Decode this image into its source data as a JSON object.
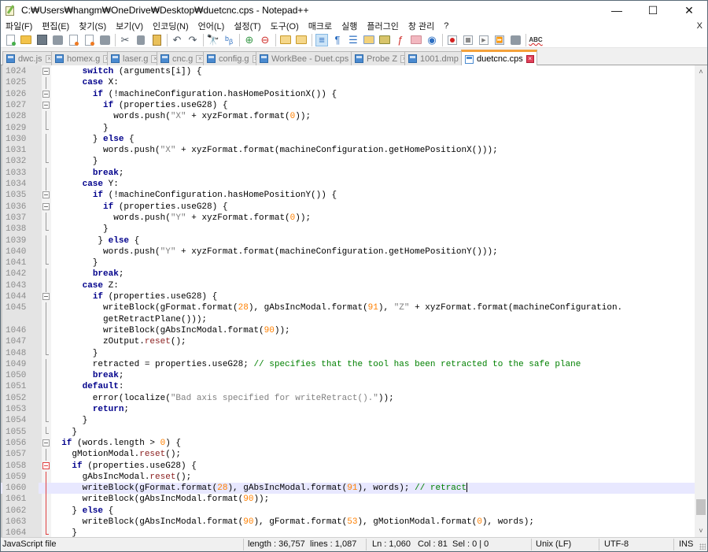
{
  "window": {
    "title": "C:₩Users₩hangm₩OneDrive₩Desktop₩duetcnc.cps - Notepad++",
    "minimize": "—",
    "maximize": "☐",
    "close": "✕"
  },
  "menu": {
    "items": [
      "파일(F)",
      "편집(E)",
      "찾기(S)",
      "보기(V)",
      "인코딩(N)",
      "언어(L)",
      "설정(T)",
      "도구(O)",
      "매크로",
      "실행",
      "플러그인",
      "창 관리",
      "?"
    ],
    "close_doc": "X"
  },
  "toolbar": {
    "icons": [
      "new-file",
      "open-file",
      "save",
      "save-all",
      "close",
      "close-all",
      "print",
      "cut",
      "copy",
      "paste",
      "undo",
      "redo",
      "find",
      "replace",
      "zoom-in",
      "zoom-out",
      "sync-vertical",
      "sync-horizontal",
      "word-wrap",
      "show-all-chars",
      "indent-guide",
      "udl",
      "doc-map",
      "function-list",
      "folder-workspace",
      "monitoring",
      "record-macro",
      "stop-recording",
      "playback-macro",
      "run-macro-multiple",
      "save-macro",
      "spell-check"
    ],
    "abc_label": "ABC"
  },
  "tabs": [
    {
      "label": "dwc.js",
      "active": false
    },
    {
      "label": "homex.g",
      "active": false
    },
    {
      "label": "laser.g",
      "active": false
    },
    {
      "label": "cnc.g",
      "active": false
    },
    {
      "label": "config.g",
      "active": false
    },
    {
      "label": "WorkBee - Duet.cps",
      "active": false
    },
    {
      "label": "Probe Z",
      "active": false
    },
    {
      "label": "1001.dmp",
      "active": false
    },
    {
      "label": "duetcnc.cps",
      "active": true
    }
  ],
  "editor": {
    "current_line": "1060",
    "lines": [
      {
        "n": "1024",
        "fold": "box"
      },
      {
        "n": "1025",
        "fold": "vline"
      },
      {
        "n": "1026",
        "fold": "box"
      },
      {
        "n": "1027",
        "fold": "box"
      },
      {
        "n": "1028",
        "fold": "vline"
      },
      {
        "n": "1029",
        "fold": "end"
      },
      {
        "n": "1030",
        "fold": "vline"
      },
      {
        "n": "1031",
        "fold": "vline"
      },
      {
        "n": "1032",
        "fold": "end"
      },
      {
        "n": "1033",
        "fold": "vline"
      },
      {
        "n": "1034",
        "fold": "vline"
      },
      {
        "n": "1035",
        "fold": "box"
      },
      {
        "n": "1036",
        "fold": "box"
      },
      {
        "n": "1037",
        "fold": "vline"
      },
      {
        "n": "1038",
        "fold": "end"
      },
      {
        "n": "1039",
        "fold": "vline"
      },
      {
        "n": "1040",
        "fold": "vline"
      },
      {
        "n": "1041",
        "fold": "end"
      },
      {
        "n": "1042",
        "fold": "vline"
      },
      {
        "n": "1043",
        "fold": "vline"
      },
      {
        "n": "1044",
        "fold": "box"
      },
      {
        "n": "1045",
        "fold": "vline"
      },
      {
        "n": "",
        "fold": "vline"
      },
      {
        "n": "1046",
        "fold": "vline"
      },
      {
        "n": "1047",
        "fold": "vline"
      },
      {
        "n": "1048",
        "fold": "end"
      },
      {
        "n": "1049",
        "fold": "vline"
      },
      {
        "n": "1050",
        "fold": "vline"
      },
      {
        "n": "1051",
        "fold": "vline"
      },
      {
        "n": "1052",
        "fold": "vline"
      },
      {
        "n": "1053",
        "fold": "vline"
      },
      {
        "n": "1054",
        "fold": "end"
      },
      {
        "n": "1055",
        "fold": "end"
      },
      {
        "n": "1056",
        "fold": "box"
      },
      {
        "n": "1057",
        "fold": "vline"
      },
      {
        "n": "1058",
        "fold": "box-red"
      },
      {
        "n": "1059",
        "fold": "vline-red"
      },
      {
        "n": "1060",
        "fold": "vline-red"
      },
      {
        "n": "1061",
        "fold": "vline-red"
      },
      {
        "n": "1062",
        "fold": "vline-red"
      },
      {
        "n": "1063",
        "fold": "vline-red"
      },
      {
        "n": "1064",
        "fold": "end-red"
      }
    ],
    "code": [
      [
        [
          "t",
          "      "
        ],
        [
          "kw",
          "switch"
        ],
        [
          "t",
          " (arguments[i]) {"
        ]
      ],
      [
        [
          "t",
          "      "
        ],
        [
          "kw",
          "case"
        ],
        [
          "t",
          " X:"
        ]
      ],
      [
        [
          "t",
          "        "
        ],
        [
          "kw",
          "if"
        ],
        [
          "t",
          " (!machineConfiguration.hasHomePositionX()) {"
        ]
      ],
      [
        [
          "t",
          "          "
        ],
        [
          "kw",
          "if"
        ],
        [
          "t",
          " (properties.useG28) {"
        ]
      ],
      [
        [
          "t",
          "            words.push("
        ],
        [
          "str",
          "\"X\""
        ],
        [
          "t",
          " + xyzFormat.format("
        ],
        [
          "num",
          "0"
        ],
        [
          "t",
          "));"
        ]
      ],
      [
        [
          "t",
          "          }"
        ]
      ],
      [
        [
          "t",
          "        } "
        ],
        [
          "kw",
          "else"
        ],
        [
          "t",
          " {"
        ]
      ],
      [
        [
          "t",
          "          words.push("
        ],
        [
          "str",
          "\"X\""
        ],
        [
          "t",
          " + xyzFormat.format(machineConfiguration.getHomePositionX()));"
        ]
      ],
      [
        [
          "t",
          "        }"
        ]
      ],
      [
        [
          "t",
          "        "
        ],
        [
          "kw",
          "break"
        ],
        [
          "t",
          ";"
        ]
      ],
      [
        [
          "t",
          "      "
        ],
        [
          "kw",
          "case"
        ],
        [
          "t",
          " Y:"
        ]
      ],
      [
        [
          "t",
          "        "
        ],
        [
          "kw",
          "if"
        ],
        [
          "t",
          " (!machineConfiguration.hasHomePositionY()) {"
        ]
      ],
      [
        [
          "t",
          "          "
        ],
        [
          "kw",
          "if"
        ],
        [
          "t",
          " (properties.useG28) {"
        ]
      ],
      [
        [
          "t",
          "            words.push("
        ],
        [
          "str",
          "\"Y\""
        ],
        [
          "t",
          " + xyzFormat.format("
        ],
        [
          "num",
          "0"
        ],
        [
          "t",
          "));"
        ]
      ],
      [
        [
          "t",
          "          }"
        ]
      ],
      [
        [
          "t",
          "         } "
        ],
        [
          "kw",
          "else"
        ],
        [
          "t",
          " {"
        ]
      ],
      [
        [
          "t",
          "          words.push("
        ],
        [
          "str",
          "\"Y\""
        ],
        [
          "t",
          " + xyzFormat.format(machineConfiguration.getHomePositionY()));"
        ]
      ],
      [
        [
          "t",
          "        }"
        ]
      ],
      [
        [
          "t",
          "        "
        ],
        [
          "kw",
          "break"
        ],
        [
          "t",
          ";"
        ]
      ],
      [
        [
          "t",
          "      "
        ],
        [
          "kw",
          "case"
        ],
        [
          "t",
          " Z:"
        ]
      ],
      [
        [
          "t",
          "        "
        ],
        [
          "kw",
          "if"
        ],
        [
          "t",
          " (properties.useG28) {"
        ]
      ],
      [
        [
          "t",
          "          writeBlock(gFormat.format("
        ],
        [
          "num",
          "28"
        ],
        [
          "t",
          "), gAbsIncModal.format("
        ],
        [
          "num",
          "91"
        ],
        [
          "t",
          "), "
        ],
        [
          "str",
          "\"Z\""
        ],
        [
          "t",
          " + xyzFormat.format(machineConfiguration."
        ]
      ],
      [
        [
          "t",
          "          getRetractPlane()));"
        ]
      ],
      [
        [
          "t",
          "          writeBlock(gAbsIncModal.format("
        ],
        [
          "num",
          "90"
        ],
        [
          "t",
          "));"
        ]
      ],
      [
        [
          "t",
          "          zOutput."
        ],
        [
          "fn",
          "reset"
        ],
        [
          "t",
          "();"
        ]
      ],
      [
        [
          "t",
          "        }"
        ]
      ],
      [
        [
          "t",
          "        retracted = properties.useG28; "
        ],
        [
          "cmt",
          "// specifies that the tool has been retracted to the safe plane"
        ]
      ],
      [
        [
          "t",
          "        "
        ],
        [
          "kw",
          "break"
        ],
        [
          "t",
          ";"
        ]
      ],
      [
        [
          "t",
          "      "
        ],
        [
          "kw",
          "default"
        ],
        [
          "t",
          ":"
        ]
      ],
      [
        [
          "t",
          "        error(localize("
        ],
        [
          "str",
          "\"Bad axis specified for writeRetract().\""
        ],
        [
          "t",
          "));"
        ]
      ],
      [
        [
          "t",
          "        "
        ],
        [
          "kw",
          "return"
        ],
        [
          "t",
          ";"
        ]
      ],
      [
        [
          "t",
          "      }"
        ]
      ],
      [
        [
          "t",
          "    }"
        ]
      ],
      [
        [
          "t",
          "  "
        ],
        [
          "kw",
          "if"
        ],
        [
          "t",
          " (words.length > "
        ],
        [
          "num",
          "0"
        ],
        [
          "t",
          ") {"
        ]
      ],
      [
        [
          "t",
          "    gMotionModal."
        ],
        [
          "fn",
          "reset"
        ],
        [
          "t",
          "();"
        ]
      ],
      [
        [
          "t",
          "    "
        ],
        [
          "kw",
          "if"
        ],
        [
          "t",
          " (properties.useG28) {"
        ]
      ],
      [
        [
          "t",
          "      gAbsIncModal."
        ],
        [
          "fn",
          "reset"
        ],
        [
          "t",
          "();"
        ]
      ],
      [
        [
          "t",
          "      writeBlock(gFormat.format("
        ],
        [
          "num",
          "28"
        ],
        [
          "t",
          "), gAbsIncModal.format("
        ],
        [
          "num",
          "91"
        ],
        [
          "t",
          "), words); "
        ],
        [
          "cmt",
          "// retract"
        ]
      ],
      [
        [
          "t",
          "      writeBlock(gAbsIncModal.format("
        ],
        [
          "num",
          "90"
        ],
        [
          "t",
          "));"
        ]
      ],
      [
        [
          "t",
          "    } "
        ],
        [
          "kw",
          "else"
        ],
        [
          "t",
          " {"
        ]
      ],
      [
        [
          "t",
          "      writeBlock(gAbsIncModal.format("
        ],
        [
          "num",
          "90"
        ],
        [
          "t",
          "), gFormat.format("
        ],
        [
          "num",
          "53"
        ],
        [
          "t",
          "), gMotionModal.format("
        ],
        [
          "num",
          "0"
        ],
        [
          "t",
          "), words);"
        ]
      ],
      [
        [
          "t",
          "    }"
        ]
      ]
    ]
  },
  "scrollbar": {
    "up": "˄",
    "down": "˅"
  },
  "statusbar": {
    "file_type": "JavaScript file",
    "length": "length : 36,757",
    "lines": "lines : 1,087",
    "ln": "Ln : 1,060",
    "col": "Col : 81",
    "sel": "Sel : 0 | 0",
    "eol": "Unix (LF)",
    "encoding": "UTF-8",
    "mode": "INS"
  },
  "colors": {
    "active_tab_accent": "#f4a13a",
    "current_line": "#e8e8ff",
    "keyword": "#00008b",
    "number": "#ff8000",
    "comment": "#008000"
  }
}
